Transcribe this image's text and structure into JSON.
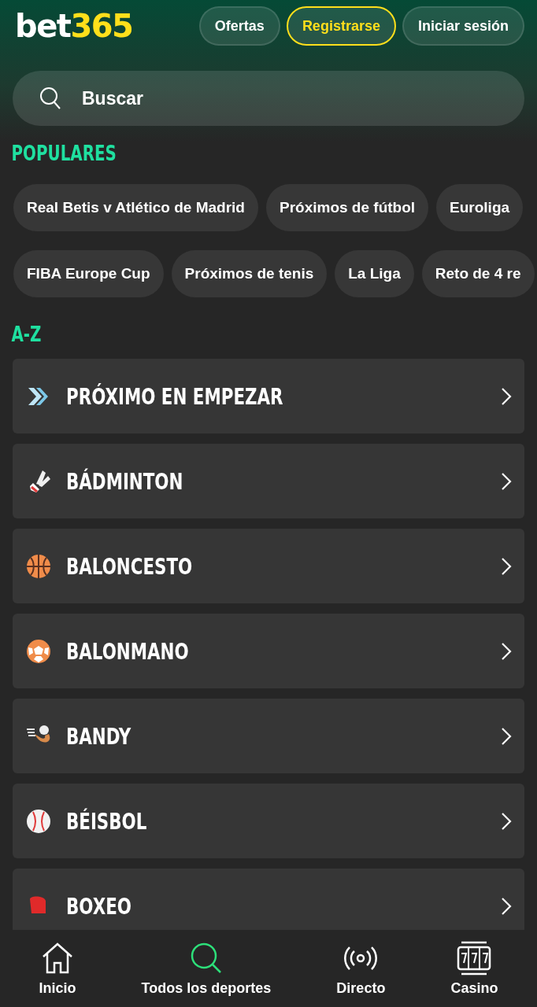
{
  "header": {
    "logo": {
      "part_1": "bet",
      "part_2": "365"
    },
    "buttons": [
      {
        "label": "Ofertas",
        "kind": "plain"
      },
      {
        "label": "Registrarse",
        "kind": "outlined"
      },
      {
        "label": "Iniciar sesión",
        "kind": "plain"
      }
    ]
  },
  "search": {
    "placeholder": "Buscar"
  },
  "popular": {
    "title": "POPULARES",
    "upper_chips": [
      "Real Betis v Atlético de Madrid",
      "Próximos de fútbol",
      "Euroliga"
    ],
    "lower_chips": [
      "FIBA Europe Cup",
      "Próximos de tenis",
      "La Liga",
      "Reto de 4 re"
    ]
  },
  "az": {
    "title": "A-Z",
    "items": [
      {
        "label": "PRÓXIMO EN EMPEZAR",
        "kind": "upcoming"
      },
      {
        "label": "BÁDMINTON",
        "kind": "badminton"
      },
      {
        "label": "BALONCESTO",
        "kind": "basketball"
      },
      {
        "label": "BALONMANO",
        "kind": "handball"
      },
      {
        "label": "BANDY",
        "kind": "bandy"
      },
      {
        "label": "BÉISBOL",
        "kind": "baseball"
      },
      {
        "label": "BOXEO",
        "kind": "boxing"
      }
    ]
  },
  "nav": [
    {
      "label": "Inicio",
      "kind": "home",
      "selected": false
    },
    {
      "label": "Todos los deportes",
      "kind": "search",
      "selected": true
    },
    {
      "label": "Directo",
      "kind": "live",
      "selected": false
    },
    {
      "label": "Casino",
      "kind": "casino",
      "selected": false
    }
  ]
}
